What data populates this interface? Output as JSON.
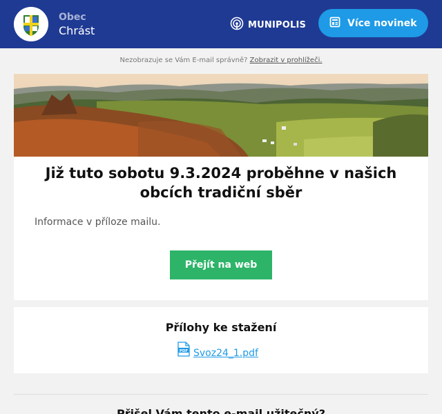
{
  "header": {
    "obec_label": "Obec",
    "obec_name": "Chrást",
    "brand": "MUNIPOLIS",
    "more_news_label": "Více novinek"
  },
  "notice": {
    "text": "Nezobrazuje se Vám E-mail správně?",
    "link": "Zobrazit v prohlížeči."
  },
  "article": {
    "title": "Již tuto sobotu 9.3.2024 proběhne v našich obcích tradiční sběr",
    "body": "Informace v příloze mailu.",
    "cta_label": "Přejít na web"
  },
  "attachments": {
    "title": "Přílohy ke stažení",
    "files": [
      {
        "name": "Svoz24_1.pdf",
        "icon": "pdf-icon"
      }
    ]
  },
  "footer": {
    "question": "Přišel Vám tento e-mail užitečný?"
  },
  "colors": {
    "header_bg": "#1f3a93",
    "accent_blue": "#1e9ae6",
    "cta_green": "#2db469",
    "page_bg": "#f2f2f2"
  }
}
